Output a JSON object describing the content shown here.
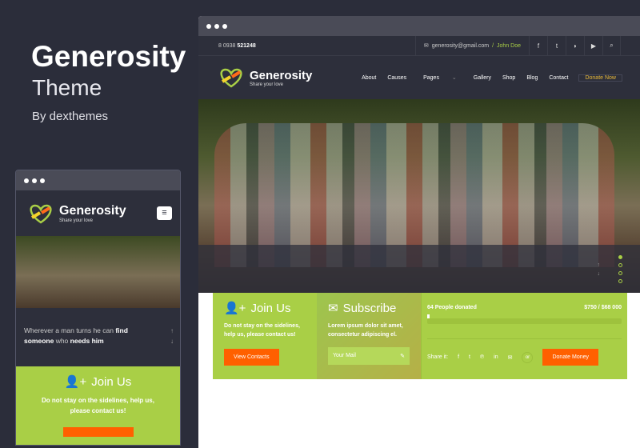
{
  "promo": {
    "title": "Generosity",
    "subtitle": "Theme",
    "by": "By dexthemes"
  },
  "desktop": {
    "topbar": {
      "phone_prefix": "8 0938",
      "phone_bold": "521248",
      "email": "generosity@gmail.com",
      "sep": "/",
      "user": "John Doe",
      "icons": [
        "facebook-icon",
        "twitter-icon",
        "rss-icon",
        "youtube-icon",
        "search-icon"
      ]
    },
    "logo": {
      "name": "Generosity",
      "tagline": "Share your love"
    },
    "menu": [
      "About",
      "Causes",
      "Pages",
      "Gallery",
      "Shop",
      "Blog",
      "Contact"
    ],
    "donate_now": "Donate Now",
    "join": {
      "title": "Join Us",
      "text": "Do not stay on the sidelines, help us, please contact us!",
      "button": "View Contacts"
    },
    "subscribe": {
      "title": "Subscribe",
      "text": "Lorem ipsum dolor sit amet, consectetur adipiscing el.",
      "placeholder": "Your Mail"
    },
    "donation": {
      "people": "64 People donated",
      "amount": "$750 / $68 000",
      "progress_percent": 1.1,
      "share_label": "Share it:",
      "or": "or",
      "button": "Donate Money"
    },
    "slider": {
      "slides": 4,
      "active": 1
    }
  },
  "mobile": {
    "logo": {
      "name": "Generosity",
      "tagline": "Share your love"
    },
    "quote": {
      "p1": "Wherever a man turns he can ",
      "b1": "find",
      "b2": "someone",
      "p2": " who ",
      "b3": "needs him"
    },
    "join": {
      "title": "Join Us",
      "text": "Do not stay on the sidelines, help us, please contact us!"
    }
  },
  "colors": {
    "accent": "#a9cf46",
    "orange": "#ff6000",
    "dark": "#2d2f3b",
    "gold": "#e8b93a"
  }
}
